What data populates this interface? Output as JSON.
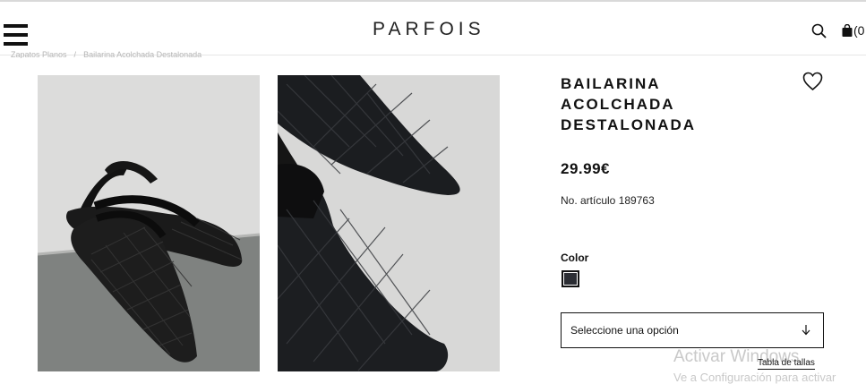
{
  "header": {
    "logo": "PARFOIS",
    "cart_count": "(0"
  },
  "breadcrumb": {
    "items": [
      "Zapatos Planos",
      "Bailarina Acolchada Destalonada"
    ],
    "separator": "/"
  },
  "product": {
    "title_lines": [
      "BAILARINA",
      "ACOLCHADA",
      "DESTALONADA"
    ],
    "price": "29.99€",
    "sku": "No. artículo 189763",
    "color_label": "Color",
    "swatch_color": "#2b2d33",
    "size_select_placeholder": "Seleccione una opción",
    "size_guide_link": "Tabla de tallas"
  },
  "os_watermark": {
    "line1": "Activar Windows",
    "line2": "Ve a Configuración para activar"
  }
}
